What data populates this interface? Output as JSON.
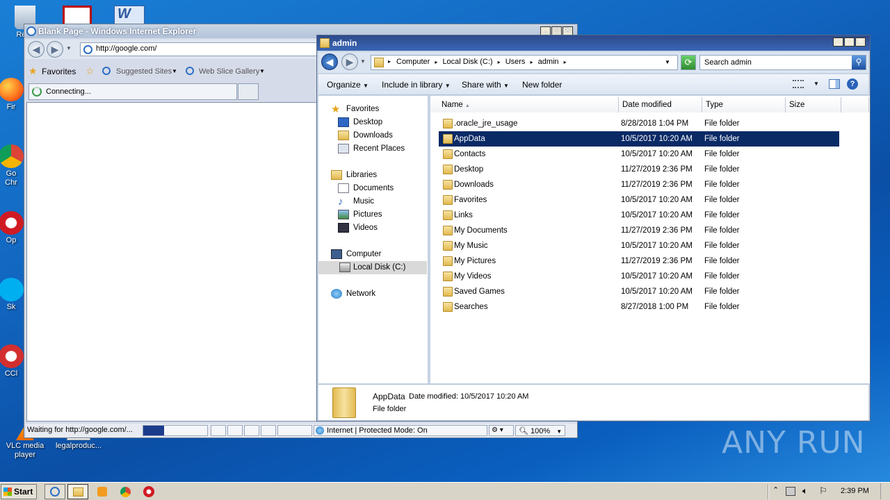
{
  "desktop": {
    "icons": [
      {
        "label": "Recy",
        "icon": "recycle-bin-icon"
      },
      {
        "label": "Fir",
        "icon": "firefox-icon"
      },
      {
        "label": "Go",
        "icon": "chrome-icon"
      },
      {
        "label": "Chr",
        "icon": "chrome-icon"
      },
      {
        "label": "Op",
        "icon": "opera-icon"
      },
      {
        "label": "Sk",
        "icon": "skype-icon"
      },
      {
        "label": "CCl",
        "icon": "ccleaner-icon"
      },
      {
        "label": "VLC media player",
        "icon": "vlc-icon"
      },
      {
        "label": "legalproduc...",
        "icon": "document-icon"
      }
    ],
    "watermark": "ANY RUN"
  },
  "ie": {
    "title": "Blank Page - Windows Internet Explorer",
    "address": "http://google.com/",
    "favorites_label": "Favorites",
    "suggested_sites": "Suggested Sites",
    "web_slice_gallery": "Web Slice Gallery",
    "tab_label": "Connecting...",
    "status_text": "Waiting for http://google.com/...",
    "zone": "Internet | Protected Mode: On",
    "zoom": "100%"
  },
  "explorer": {
    "title": "admin",
    "breadcrumb": [
      "Computer",
      "Local Disk (C:)",
      "Users",
      "admin"
    ],
    "search_placeholder": "Search admin",
    "commands": {
      "organize": "Organize",
      "include": "Include in library",
      "share": "Share with",
      "new_folder": "New folder"
    },
    "tree": {
      "favorites": "Favorites",
      "desktop": "Desktop",
      "downloads": "Downloads",
      "recent": "Recent Places",
      "libraries": "Libraries",
      "documents": "Documents",
      "music": "Music",
      "pictures": "Pictures",
      "videos": "Videos",
      "computer": "Computer",
      "local_disk": "Local Disk (C:)",
      "network": "Network"
    },
    "columns": {
      "name": "Name",
      "date": "Date modified",
      "type": "Type",
      "size": "Size"
    },
    "rows": [
      {
        "name": ".oracle_jre_usage",
        "date": "8/28/2018 1:04 PM",
        "type": "File folder"
      },
      {
        "name": "AppData",
        "date": "10/5/2017 10:20 AM",
        "type": "File folder"
      },
      {
        "name": "Contacts",
        "date": "10/5/2017 10:20 AM",
        "type": "File folder"
      },
      {
        "name": "Desktop",
        "date": "11/27/2019 2:36 PM",
        "type": "File folder"
      },
      {
        "name": "Downloads",
        "date": "11/27/2019 2:36 PM",
        "type": "File folder"
      },
      {
        "name": "Favorites",
        "date": "10/5/2017 10:20 AM",
        "type": "File folder"
      },
      {
        "name": "Links",
        "date": "10/5/2017 10:20 AM",
        "type": "File folder"
      },
      {
        "name": "My Documents",
        "date": "11/27/2019 2:36 PM",
        "type": "File folder"
      },
      {
        "name": "My Music",
        "date": "10/5/2017 10:20 AM",
        "type": "File folder"
      },
      {
        "name": "My Pictures",
        "date": "11/27/2019 2:36 PM",
        "type": "File folder"
      },
      {
        "name": "My Videos",
        "date": "10/5/2017 10:20 AM",
        "type": "File folder"
      },
      {
        "name": "Saved Games",
        "date": "10/5/2017 10:20 AM",
        "type": "File folder"
      },
      {
        "name": "Searches",
        "date": "8/27/2018 1:00 PM",
        "type": "File folder"
      }
    ],
    "details": {
      "name": "AppData",
      "date_label": "Date modified:",
      "date": "10/5/2017 10:20 AM",
      "type": "File folder"
    }
  },
  "taskbar": {
    "start": "Start",
    "clock": "2:39 PM"
  }
}
